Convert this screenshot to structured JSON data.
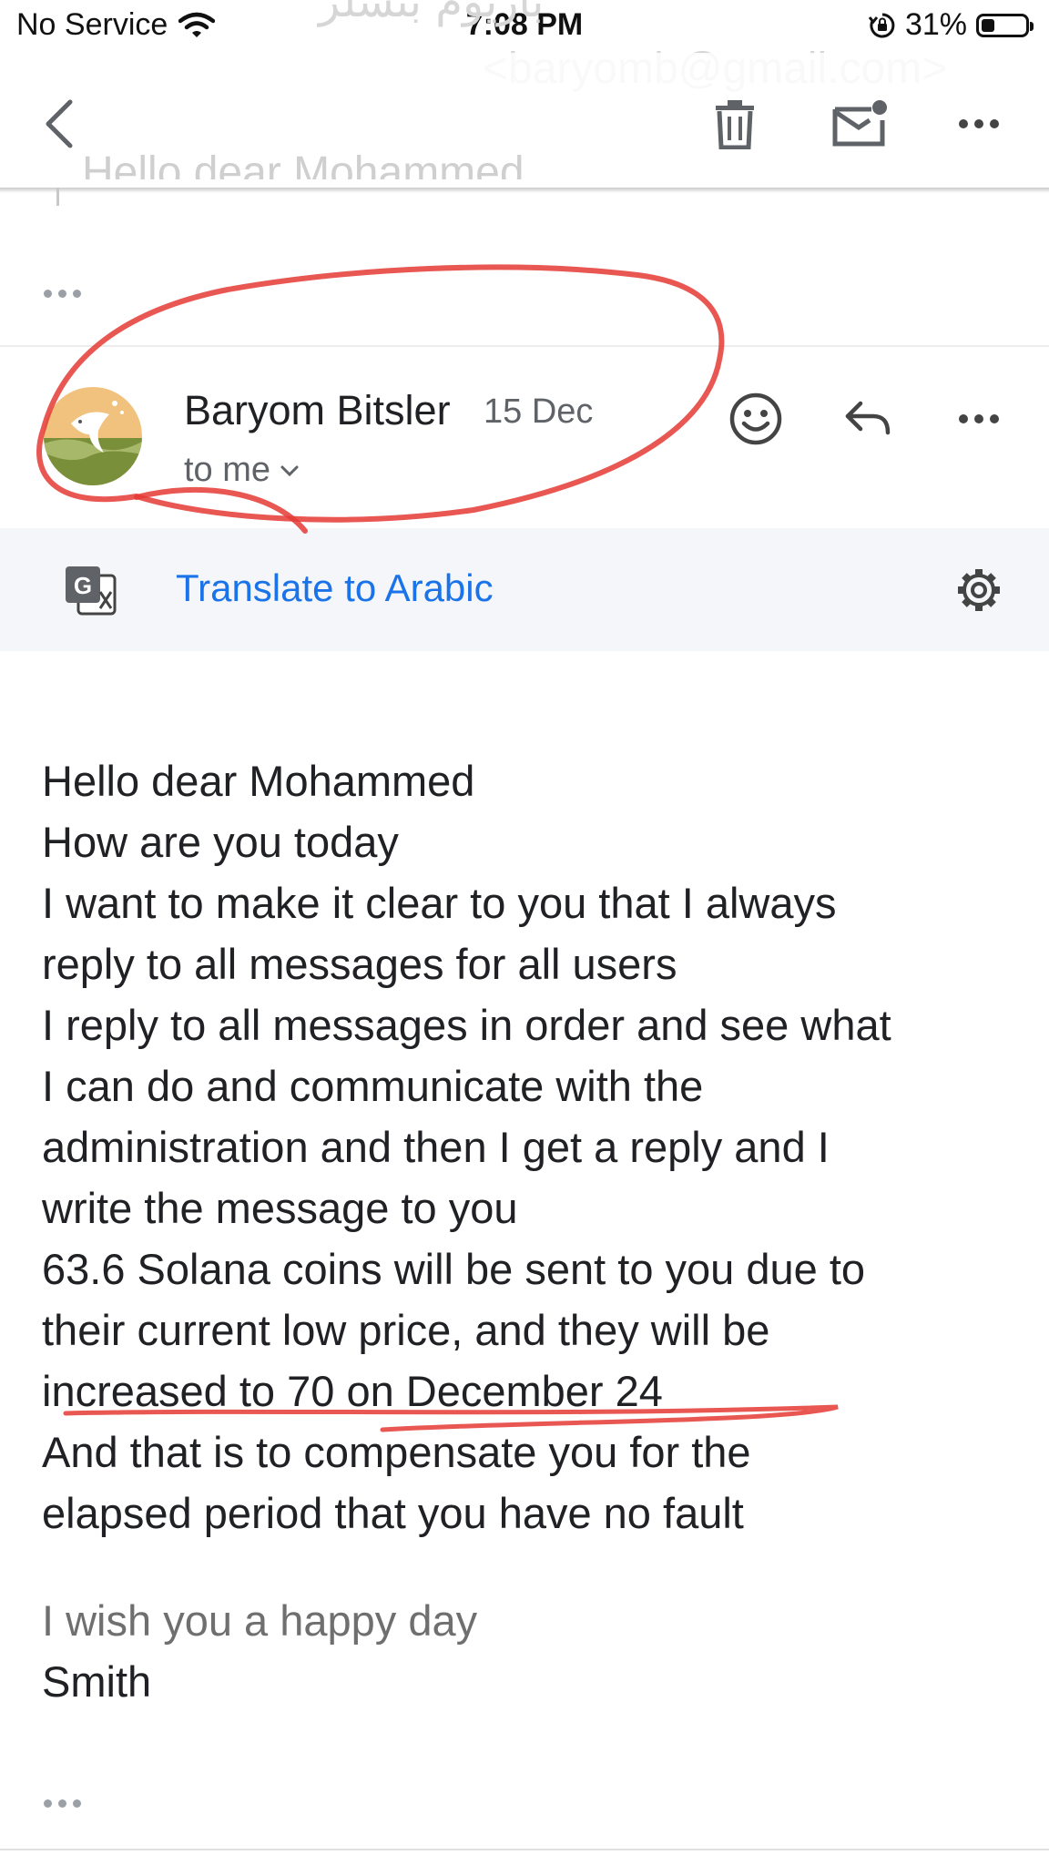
{
  "status_bar": {
    "carrier": "No Service",
    "time": "7:08 PM",
    "battery_percent": "31%",
    "battery_level": 0.31,
    "icons": [
      "wifi-icon",
      "orientation-lock-icon",
      "battery-icon"
    ]
  },
  "background_scrolled": {
    "arabic_name": "باريوم بتسلر",
    "email": "<baryomb@gmail.com>",
    "preview_line": "Hello dear Mohammed"
  },
  "toolbar": {
    "icons": [
      "back-chevron-icon",
      "trash-icon",
      "mark-unread-icon",
      "more-options-icon"
    ]
  },
  "message": {
    "sender_name": "Baryom Bitsler",
    "date": "15 Dec",
    "recipient": "to me",
    "actions": [
      "emoji-reaction-icon",
      "reply-icon",
      "more-options-icon"
    ]
  },
  "translate": {
    "label": "Translate to Arabic",
    "icons": [
      "google-translate-icon",
      "settings-gear-icon"
    ]
  },
  "body": {
    "lines": [
      "Hello dear Mohammed",
      "How are you today",
      "I want to make it clear to you that I always",
      "reply to all messages for all users",
      "I reply to all messages in order and see what",
      "I can do and communicate with the",
      "administration and then I get a reply and I",
      "write the message to you",
      "63.6 Solana coins will be sent to you due to",
      "their current low price, and they will be",
      "increased to 70 on December 24",
      "And that is to compensate you for the",
      "elapsed period that you have no fault"
    ],
    "closing": "I wish you a happy day",
    "signature": "Smith"
  },
  "colors": {
    "link_blue": "#1a73e8",
    "annotation_red": "#e53935",
    "translate_bar_bg": "#f4f6f9"
  }
}
